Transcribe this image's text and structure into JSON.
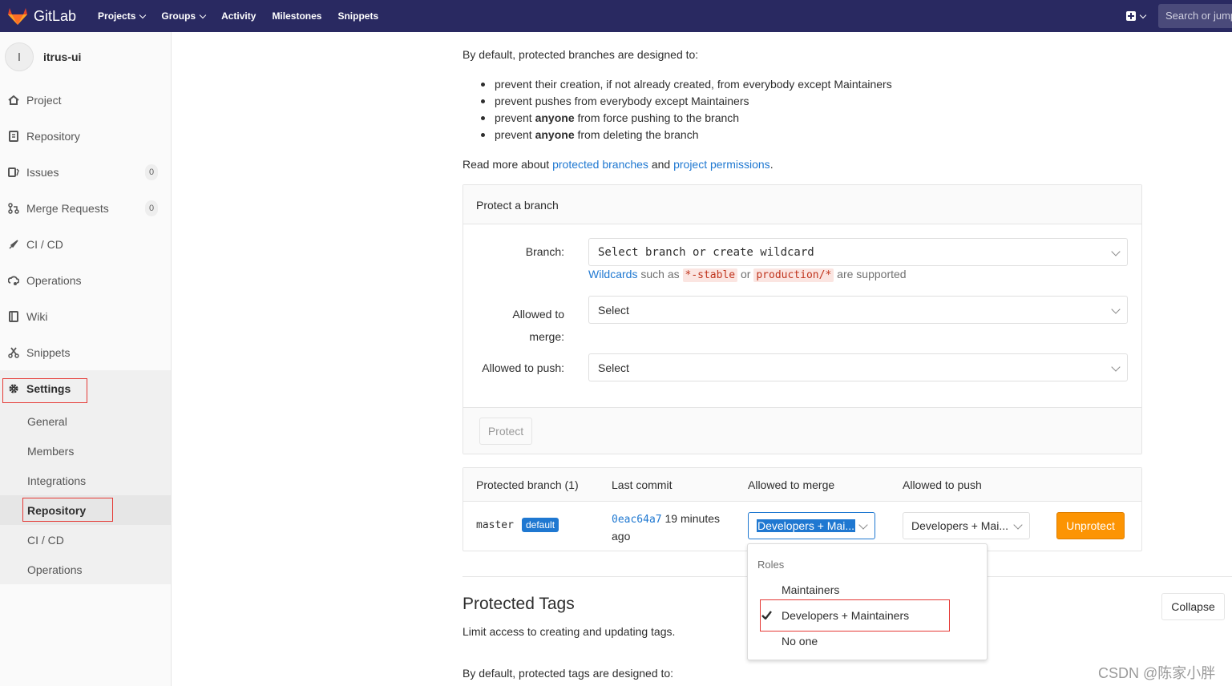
{
  "app": {
    "logo_text": "GitLab"
  },
  "nav": {
    "links": [
      "Projects",
      "Groups",
      "Activity",
      "Milestones",
      "Snippets"
    ],
    "search_placeholder": "Search or jump to..."
  },
  "sidebar": {
    "avatar_letter": "I",
    "project_name": "itrus-ui",
    "items": [
      {
        "label": "Project",
        "icon": "home-icon"
      },
      {
        "label": "Repository",
        "icon": "doc-icon"
      },
      {
        "label": "Issues",
        "icon": "issues-icon",
        "count": "0"
      },
      {
        "label": "Merge Requests",
        "icon": "merge-icon",
        "count": "0"
      },
      {
        "label": "CI / CD",
        "icon": "rocket-icon"
      },
      {
        "label": "Operations",
        "icon": "cloud-gear-icon"
      },
      {
        "label": "Wiki",
        "icon": "book-icon"
      },
      {
        "label": "Snippets",
        "icon": "scissors-icon"
      },
      {
        "label": "Settings",
        "icon": "gear-icon"
      }
    ],
    "sub_items": [
      "General",
      "Members",
      "Integrations",
      "Repository",
      "CI / CD",
      "Operations"
    ]
  },
  "intro": {
    "lead": "By default, protected branches are designed to:",
    "bullets": [
      {
        "pre": "prevent their creation, if not already created, from everybody except Maintainers",
        "bold": "",
        "post": ""
      },
      {
        "pre": "prevent pushes from everybody except Maintainers",
        "bold": "",
        "post": ""
      },
      {
        "pre": "prevent ",
        "bold": "anyone",
        "post": " from force pushing to the branch"
      },
      {
        "pre": "prevent ",
        "bold": "anyone",
        "post": " from deleting the branch"
      }
    ],
    "readmore_pre": "Read more about ",
    "readmore_link1": "protected branches",
    "readmore_mid": " and ",
    "readmore_link2": "project permissions",
    "readmore_post": "."
  },
  "protect_form": {
    "title": "Protect a branch",
    "branch_label": "Branch:",
    "branch_placeholder": "Select branch or create wildcard",
    "help_link": "Wildcards",
    "help_mid1": " such as ",
    "help_code1": "*-stable",
    "help_mid2": " or ",
    "help_code2": "production/*",
    "help_post": " are supported",
    "merge_label_line1": "Allowed to",
    "merge_label_line2": "merge:",
    "merge_value": "Select",
    "push_label": "Allowed to push:",
    "push_value": "Select",
    "protect_button": "Protect"
  },
  "protected_table": {
    "headers": [
      "Protected branch (1)",
      "Last commit",
      "Allowed to merge",
      "Allowed to push"
    ],
    "row": {
      "branch": "master",
      "badge": "default",
      "commit_sha": "0eac64a7",
      "commit_time_1": "19 minutes",
      "commit_time_2": "ago",
      "merge_value": "Developers + Mai...",
      "push_value": "Developers + Mai...",
      "unprotect_button": "Unprotect"
    }
  },
  "dropdown": {
    "header": "Roles",
    "options": [
      "Maintainers",
      "Developers + Maintainers",
      "No one"
    ],
    "selected_index": 1
  },
  "tags_section": {
    "title": "Protected Tags",
    "subtitle": "Limit access to creating and updating tags.",
    "collapse_button": "Collapse",
    "lead": "By default, protected tags are designed to:"
  },
  "watermark": "CSDN @陈家小胖",
  "colors": {
    "nav_bg": "#292961",
    "link": "#1f78d1",
    "warning": "#fc9403",
    "highlight_box": "#e53935"
  }
}
